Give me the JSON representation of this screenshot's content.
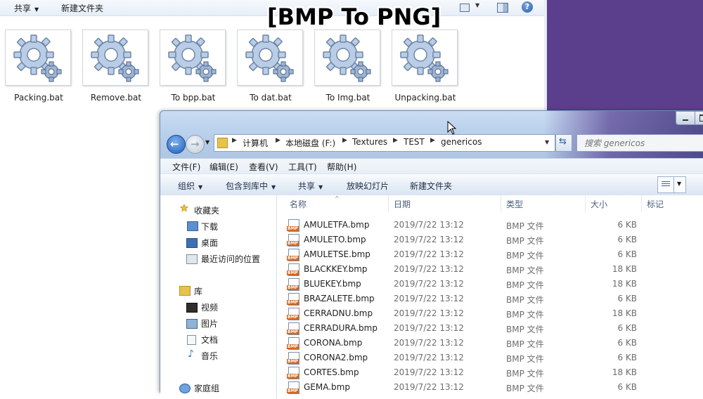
{
  "background_window": {
    "toolbar": {
      "share_label": "共享",
      "new_folder_label": "新建文件夹"
    },
    "files": [
      {
        "name": "Packing.bat"
      },
      {
        "name": "Remove.bat"
      },
      {
        "name": "To bpp.bat"
      },
      {
        "name": "To dat.bat"
      },
      {
        "name": "To Img.bat"
      },
      {
        "name": "Unpacking.bat"
      }
    ],
    "icon": "gear-batch-file-icon"
  },
  "banner": {
    "text": "[BMP To PNG]"
  },
  "explorer": {
    "breadcrumb": [
      "计算机",
      "本地磁盘 (F:)",
      "Textures",
      "TEST",
      "genericos"
    ],
    "search_placeholder": "搜索 genericos",
    "menu": [
      "文件(F)",
      "编辑(E)",
      "查看(V)",
      "工具(T)",
      "帮助(H)"
    ],
    "commands": {
      "organize": "组织",
      "include_in_library": "包含到库中",
      "share": "共享",
      "slideshow": "放映幻灯片",
      "new_folder": "新建文件夹"
    },
    "nav": {
      "favorites": "收藏夹",
      "downloads": "下载",
      "desktop": "桌面",
      "recent": "最近访问的位置",
      "libraries": "库",
      "videos": "视频",
      "pictures": "图片",
      "documents": "文档",
      "music": "音乐",
      "homegroup": "家庭组"
    },
    "columns": {
      "name": "名称",
      "date": "日期",
      "type": "类型",
      "size": "大小",
      "tags": "标记"
    },
    "rows": [
      {
        "name": "AMULETFA.bmp",
        "date": "2019/7/22 13:12",
        "type": "BMP 文件",
        "size": "6 KB"
      },
      {
        "name": "AMULETO.bmp",
        "date": "2019/7/22 13:12",
        "type": "BMP 文件",
        "size": "6 KB"
      },
      {
        "name": "AMULETSE.bmp",
        "date": "2019/7/22 13:12",
        "type": "BMP 文件",
        "size": "6 KB"
      },
      {
        "name": "BLACKKEY.bmp",
        "date": "2019/7/22 13:12",
        "type": "BMP 文件",
        "size": "18 KB"
      },
      {
        "name": "BLUEKEY.bmp",
        "date": "2019/7/22 13:12",
        "type": "BMP 文件",
        "size": "18 KB"
      },
      {
        "name": "BRAZALETE.bmp",
        "date": "2019/7/22 13:12",
        "type": "BMP 文件",
        "size": "6 KB"
      },
      {
        "name": "CERRADNU.bmp",
        "date": "2019/7/22 13:12",
        "type": "BMP 文件",
        "size": "18 KB"
      },
      {
        "name": "CERRADURA.bmp",
        "date": "2019/7/22 13:12",
        "type": "BMP 文件",
        "size": "6 KB"
      },
      {
        "name": "CORONA.bmp",
        "date": "2019/7/22 13:12",
        "type": "BMP 文件",
        "size": "6 KB"
      },
      {
        "name": "CORONA2.bmp",
        "date": "2019/7/22 13:12",
        "type": "BMP 文件",
        "size": "6 KB"
      },
      {
        "name": "CORTES.bmp",
        "date": "2019/7/22 13:12",
        "type": "BMP 文件",
        "size": "18 KB"
      },
      {
        "name": "GEMA.bmp",
        "date": "2019/7/22 13:12",
        "type": "BMP 文件",
        "size": "6 KB"
      }
    ]
  },
  "colors": {
    "desktop_purple": "#5b3f8c",
    "accent_blue": "#1f5fb8"
  }
}
